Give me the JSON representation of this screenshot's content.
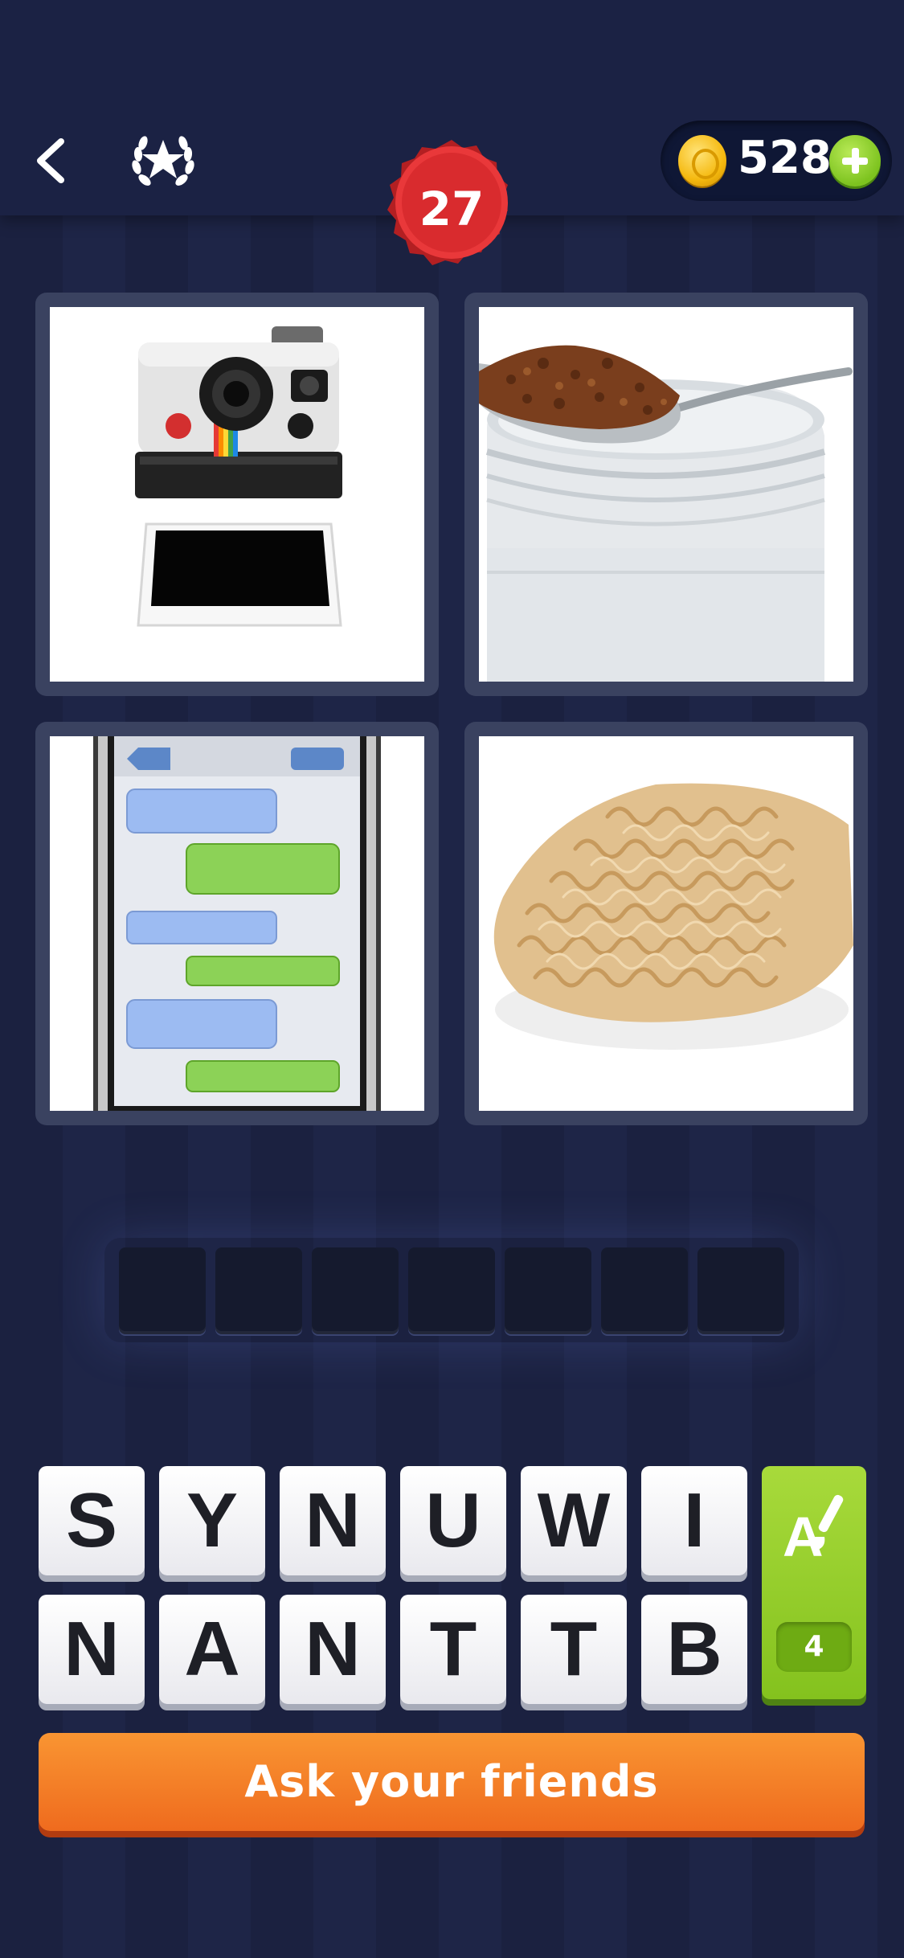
{
  "header": {
    "coins": "528",
    "level": "27"
  },
  "icons": {
    "back": "chevron-left-icon",
    "achievements": "laurel-star-icon",
    "coin": "gold-coin-icon",
    "add_coins": "plus-icon",
    "hint": "letter-brush-icon"
  },
  "pictures": [
    {
      "subject": "instant camera"
    },
    {
      "subject": "instant coffee in spoon over jar"
    },
    {
      "subject": "text messages on phone"
    },
    {
      "subject": "instant noodles"
    }
  ],
  "answer": {
    "slots": [
      "",
      "",
      "",
      "",
      "",
      "",
      ""
    ]
  },
  "letters": {
    "row1": [
      "S",
      "Y",
      "N",
      "U",
      "W",
      "I"
    ],
    "row2": [
      "N",
      "A",
      "N",
      "T",
      "T",
      "B"
    ]
  },
  "hint": {
    "count": "4"
  },
  "ask_button": {
    "label": "Ask your friends"
  },
  "colors": {
    "background": "#1e2547",
    "level_badge": "#e52d2d",
    "hint_green": "#8cc63f",
    "ask_orange": "#f58025"
  }
}
